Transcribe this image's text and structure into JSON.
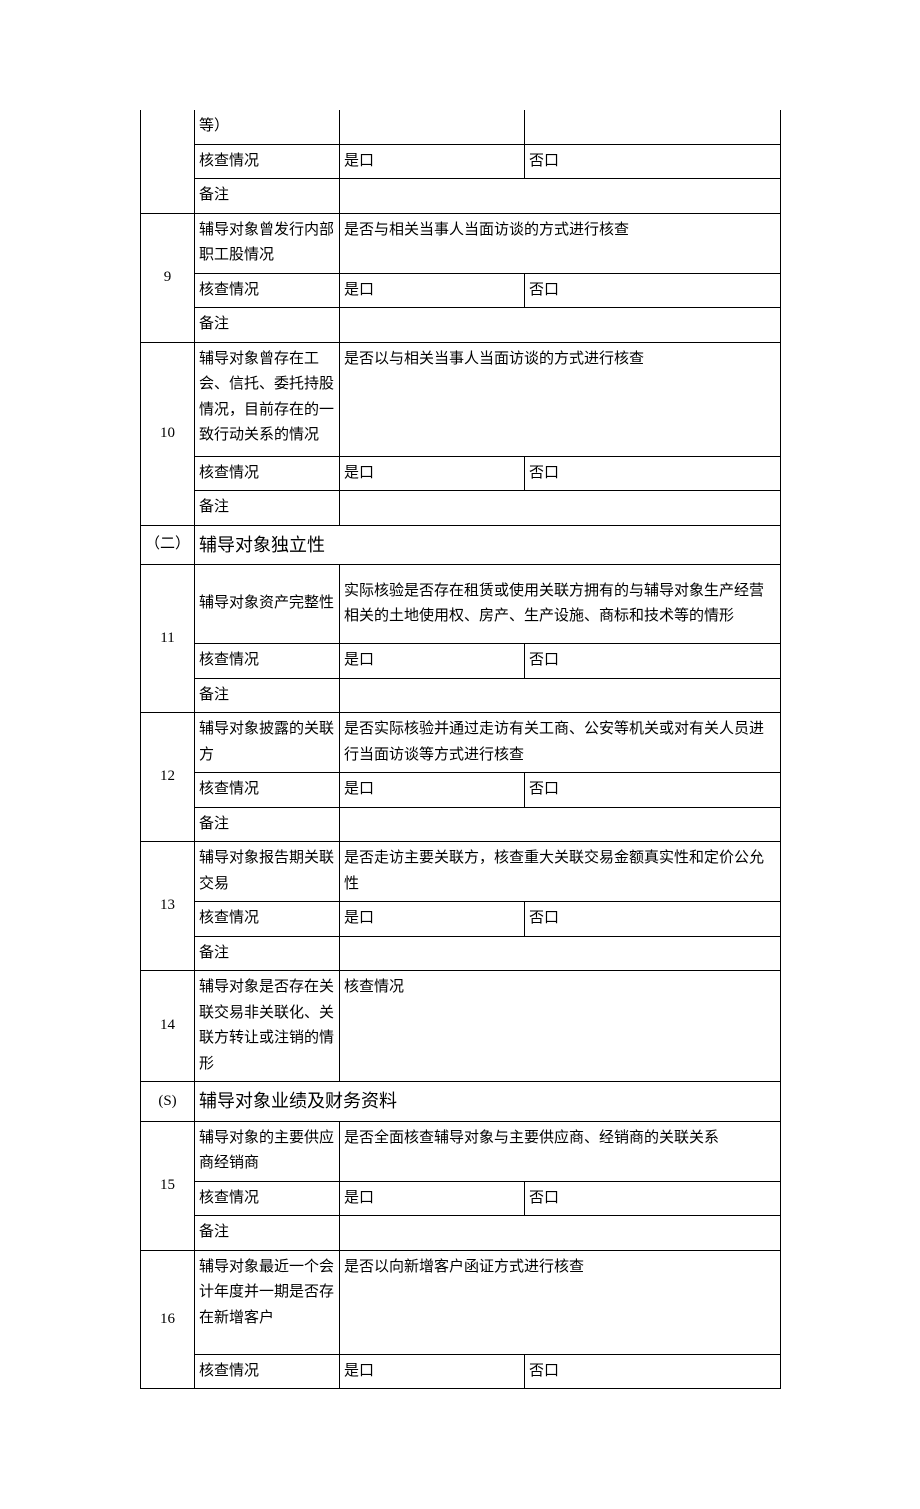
{
  "r8": {
    "topCell": "等）",
    "check": "核查情况",
    "yes": "是口",
    "no": "否口",
    "note": "备注"
  },
  "r9": {
    "num": "9",
    "title": "辅导对象曾发行内部职工股情况",
    "desc": "是否与相关当事人当面访谈的方式进行核查",
    "check": "核查情况",
    "yes": "是口",
    "no": "否口",
    "note": "备注"
  },
  "r10": {
    "num": "10",
    "title": "辅导对象曾存在工会、信托、委托持股情况，目前存在的一致行动关系的情况",
    "desc": "是否以与相关当事人当面访谈的方式进行核查",
    "check": "核查情况",
    "yes": "是口",
    "no": "否口",
    "note": "备注"
  },
  "s2": {
    "num": "（二）",
    "title": "辅导对象独立性"
  },
  "r11": {
    "num": "11",
    "title": "辅导对象资产完整性",
    "desc": "实际核验是否存在租赁或使用关联方拥有的与辅导对象生产经营相关的土地使用权、房产、生产设施、商标和技术等的情形",
    "check": "核查情况",
    "yes": "是口",
    "no": "否口",
    "note": "备注"
  },
  "r12": {
    "num": "12",
    "title": "辅导对象披露的关联方",
    "desc": "是否实际核验并通过走访有关工商、公安等机关或对有关人员进行当面访谈等方式进行核查",
    "check": "核查情况",
    "yes": "是口",
    "no": "否口",
    "note": "备注"
  },
  "r13": {
    "num": "13",
    "title": "辅导对象报告期关联交易",
    "desc": "是否走访主要关联方，核查重大关联交易金额真实性和定价公允性",
    "check": "核查情况",
    "yes": "是口",
    "no": "否口",
    "note": "备注"
  },
  "r14": {
    "num": "14",
    "title": "辅导对象是否存在关联交易非关联化、关联方转让或注销的情形",
    "desc": "核查情况"
  },
  "sS": {
    "num": "(S)",
    "title": "辅导对象业绩及财务资料"
  },
  "r15": {
    "num": "15",
    "title": "辅导对象的主要供应商经销商",
    "desc": "是否全面核查辅导对象与主要供应商、经销商的关联关系",
    "check": "核查情况",
    "yes": "是口",
    "no": "否口",
    "note": "备注"
  },
  "r16": {
    "num": "16",
    "title": "辅导对象最近一个会计年度并一期是否存在新增客户",
    "desc": "是否以向新增客户函证方式进行核查",
    "check": "核查情况",
    "yes": "是口",
    "no": "否口"
  }
}
